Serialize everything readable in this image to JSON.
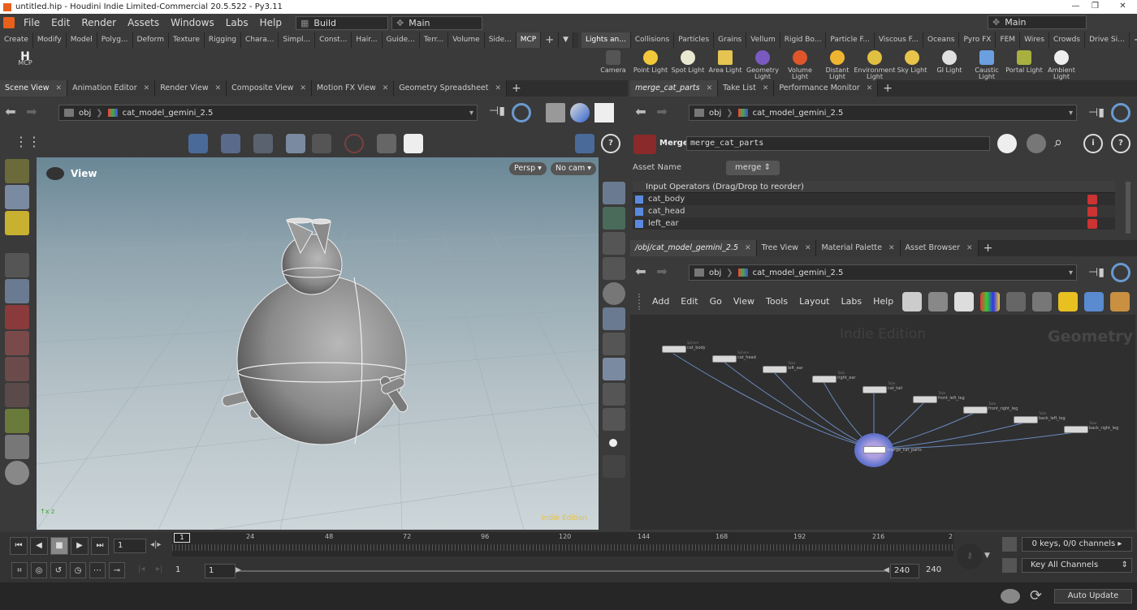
{
  "window": {
    "title": "untitled.hip - Houdini Indie Limited-Commercial 20.5.522 - Py3.11"
  },
  "menu": {
    "items": [
      "File",
      "Edit",
      "Render",
      "Assets",
      "Windows",
      "Labs",
      "Help"
    ],
    "desktop": "Build",
    "main_left": "Main",
    "main_right": "Main"
  },
  "shelf_tabs_left": [
    "Create",
    "Modify",
    "Model",
    "Polyg...",
    "Deform",
    "Texture",
    "Rigging",
    "Chara...",
    "Simpl...",
    "Const...",
    "Hair...",
    "Guide...",
    "Terr...",
    "Volume",
    "Side...",
    "MCP"
  ],
  "shelf_left_tool": {
    "label": "MCP",
    "glyph": "H"
  },
  "shelf_tabs_right": [
    "Lights an...",
    "Collisions",
    "Particles",
    "Grains",
    "Vellum",
    "Rigid Bo...",
    "Particle F...",
    "Viscous F...",
    "Oceans",
    "Pyro FX",
    "FEM",
    "Wires",
    "Crowds",
    "Drive Si..."
  ],
  "shelf_right_tools": [
    "Camera",
    "Point Light",
    "Spot Light",
    "Area Light",
    "Geometry Light",
    "Volume Light",
    "Distant Light",
    "Environment Light",
    "Sky Light",
    "GI Light",
    "Caustic Light",
    "Portal Light",
    "Ambient Light"
  ],
  "left_tabs": [
    "Scene View",
    "Animation Editor",
    "Render View",
    "Composite View",
    "Motion FX View",
    "Geometry Spreadsheet"
  ],
  "left_path": {
    "ctx": "obj",
    "node": "cat_model_gemini_2.5"
  },
  "viewport": {
    "label": "View",
    "persp": "Persp",
    "cam": "No cam",
    "watermark": "Indie Edition"
  },
  "param_tabs": [
    "merge_cat_parts",
    "Take List",
    "Performance Monitor"
  ],
  "param_path": {
    "ctx": "obj",
    "node": "cat_model_gemini_2.5"
  },
  "params": {
    "node_type": "Merge",
    "node_name": "merge_cat_parts",
    "asset_label": "Asset Name",
    "asset_value": "merge",
    "inputs_header": "Input Operators (Drag/Drop to reorder)",
    "inputs": [
      "cat_body",
      "cat_head",
      "left_ear"
    ]
  },
  "net_tabs": [
    "/obj/cat_model_gemini_2.5",
    "Tree View",
    "Material Palette",
    "Asset Browser"
  ],
  "net_path": {
    "ctx": "obj",
    "node": "cat_model_gemini_2.5"
  },
  "net_menu": [
    "Add",
    "Edit",
    "Go",
    "View",
    "Tools",
    "Layout",
    "Labs",
    "Help"
  ],
  "network": {
    "edition": "Indie Edition",
    "context": "Geometry",
    "nodes": [
      {
        "name": "cat_body",
        "type": "Sphere"
      },
      {
        "name": "cat_head",
        "type": "Sphere"
      },
      {
        "name": "left_ear",
        "type": "Tube"
      },
      {
        "name": "right_ear",
        "type": "Tube"
      },
      {
        "name": "cat_tail",
        "type": "Tube"
      },
      {
        "name": "front_left_leg",
        "type": "Tube"
      },
      {
        "name": "front_right_leg",
        "type": "Tube"
      },
      {
        "name": "back_left_leg",
        "type": "Tube"
      },
      {
        "name": "back_right_leg",
        "type": "Tube"
      }
    ],
    "merge": "merge_cat_parts"
  },
  "timeline": {
    "frame": "1",
    "ticks": [
      "24",
      "48",
      "72",
      "96",
      "120",
      "144",
      "168",
      "192",
      "216",
      "2"
    ],
    "range_start": "1",
    "range_start2": "1",
    "range_end": "240",
    "range_end2": "240",
    "playhead": "1",
    "keys_info": "0 keys, 0/0 channels",
    "key_mode": "Key All Channels",
    "update_mode": "Auto Update"
  }
}
